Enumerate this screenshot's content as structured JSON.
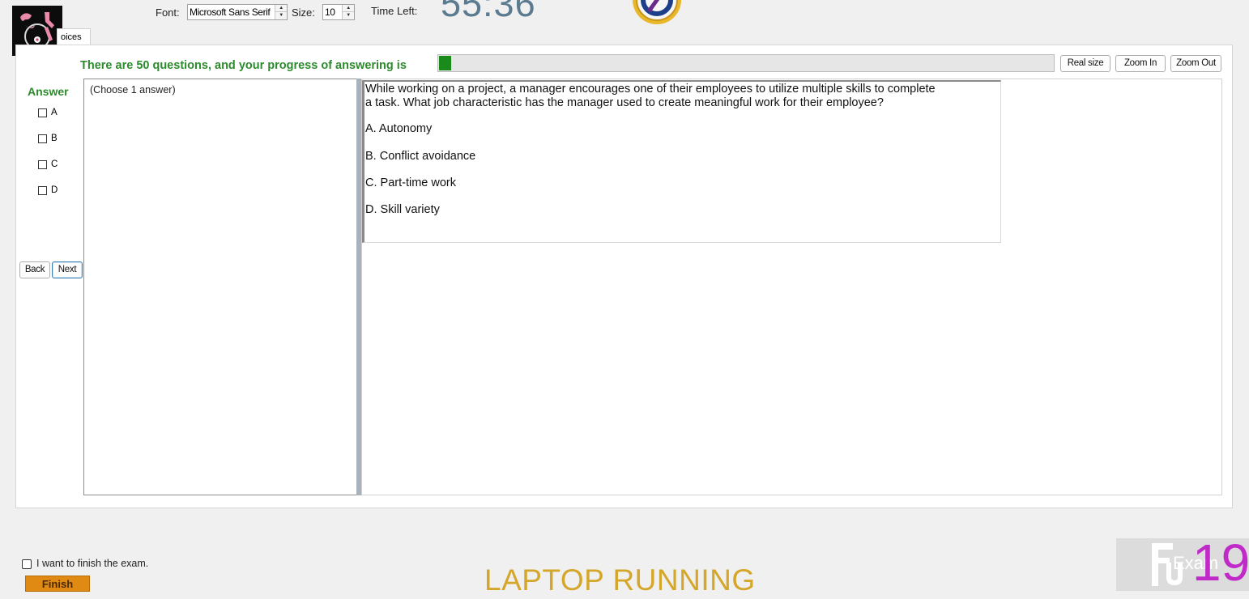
{
  "toolbar": {
    "font_label": "Font:",
    "font_value": "Microsoft Sans Serif",
    "size_label": "Size:",
    "size_value": "10",
    "time_left_label": "Time Left:",
    "time_left_value": "55:36"
  },
  "tab": {
    "label": "oices"
  },
  "progress": {
    "label": "There are 50 questions, and your progress of answering is",
    "fraction": 0.02
  },
  "zoom": {
    "real_size": "Real size",
    "zoom_in": "Zoom In",
    "zoom_out": "Zoom Out"
  },
  "answer": {
    "title": "Answer",
    "options": [
      "A",
      "B",
      "C",
      "D"
    ],
    "instruction": "(Choose 1 answer)"
  },
  "nav": {
    "back": "Back",
    "next": "Next"
  },
  "question": {
    "line1": "While working on a project, a manager encourages one of their employees to utilize multiple skills to complete",
    "line2": "a task. What job characteristic has the manager used to create meaningful work for their employee?",
    "choices": [
      "A.  Autonomy",
      "B.  Conflict avoidance",
      "C.  Part-time work",
      "D.  Skill variety"
    ]
  },
  "footer": {
    "finish_checkbox_label": "I want to finish the exam.",
    "finish_button": "Finish",
    "banner": "LAPTOP RUNNING",
    "brand_number": "19",
    "brand_word": "Exam"
  },
  "colors": {
    "accent_green": "#2d8a2d",
    "progress_green": "#1a8a1a",
    "timer": "#5b7b90",
    "finish_orange": "#e08a14",
    "banner_gold": "#d4a62a",
    "brand_magenta": "#c02ac8"
  }
}
